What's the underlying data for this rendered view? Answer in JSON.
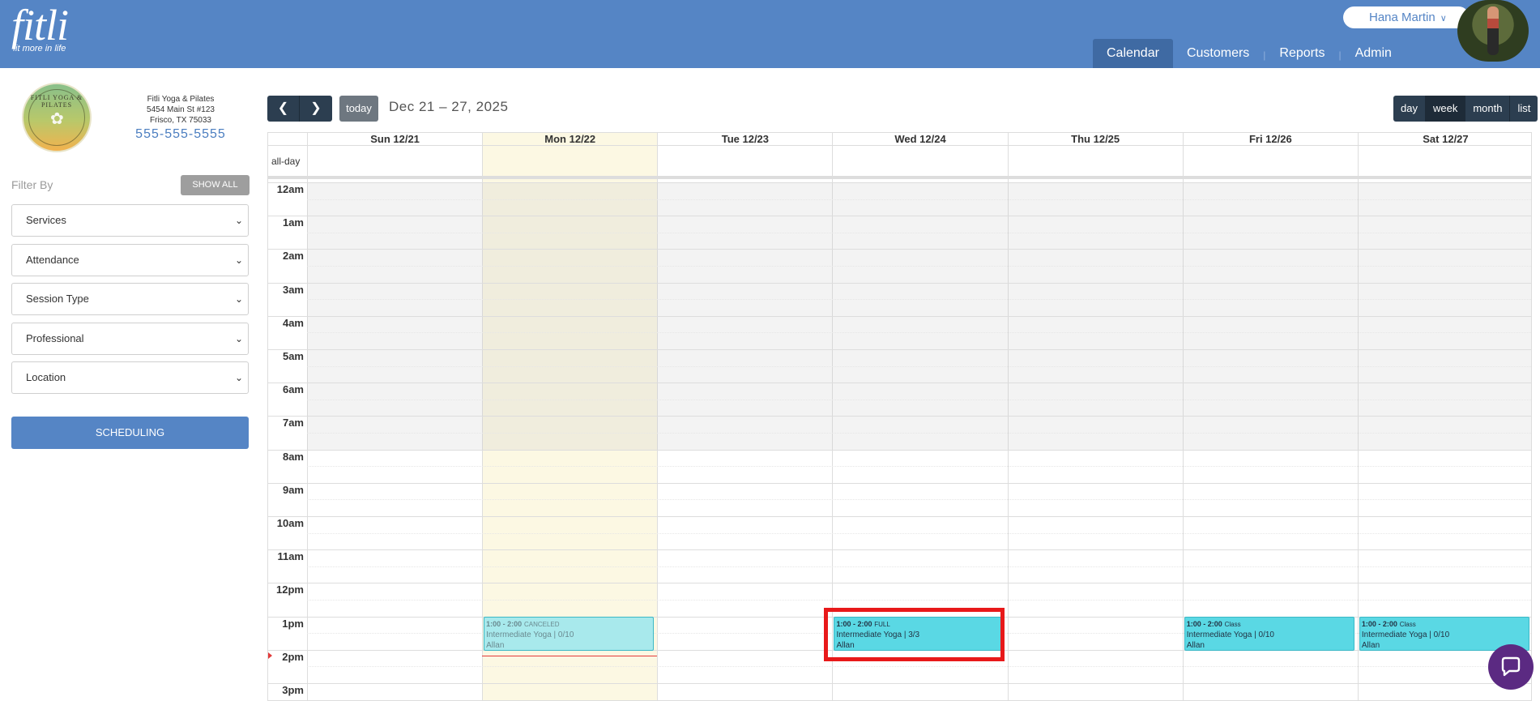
{
  "app": {
    "logo": "fitli",
    "tagline": "fit more in life"
  },
  "user": {
    "name": "Hana Martin"
  },
  "nav": {
    "items": [
      "Calendar",
      "Customers",
      "Reports",
      "Admin"
    ],
    "active": "Calendar"
  },
  "studio": {
    "logo_text": "FITLI YOGA & PILATES",
    "name": "Fitli Yoga & Pilates",
    "address1": "5454 Main St #123",
    "address2": "Frisco, TX 75033",
    "phone": "555-555-5555"
  },
  "filters": {
    "label": "Filter By",
    "show_all": "SHOW ALL",
    "selects": [
      "Services",
      "Attendance",
      "Session Type",
      "Professional",
      "Location"
    ]
  },
  "scheduling_button": "SCHEDULING",
  "toolbar": {
    "today": "today",
    "range_title": "Dec 21 – 27, 2025",
    "views": [
      "day",
      "week",
      "month",
      "list"
    ],
    "active_view": "week"
  },
  "calendar": {
    "days": [
      "Sun 12/21",
      "Mon 12/22",
      "Tue 12/23",
      "Wed 12/24",
      "Thu 12/25",
      "Fri 12/26",
      "Sat 12/27"
    ],
    "today_index": 1,
    "allday_label": "all-day",
    "hours": [
      "12am",
      "1am",
      "2am",
      "3am",
      "4am",
      "5am",
      "6am",
      "7am",
      "8am",
      "9am",
      "10am",
      "11am",
      "12pm",
      "1pm",
      "2pm",
      "3pm"
    ],
    "events": [
      {
        "day": 1,
        "time": "1:00 - 2:00",
        "tag": "CANCELED",
        "title": "Intermediate Yoga | 0/10",
        "instructor": "Allan",
        "canceled": true
      },
      {
        "day": 3,
        "time": "1:00 - 2:00",
        "tag": "FULL",
        "title": "Intermediate Yoga | 3/3",
        "instructor": "Allan",
        "highlighted": true
      },
      {
        "day": 5,
        "time": "1:00 - 2:00",
        "tag": "Class",
        "title": "Intermediate Yoga | 0/10",
        "instructor": "Allan"
      },
      {
        "day": 6,
        "time": "1:00 - 2:00",
        "tag": "Class",
        "title": "Intermediate Yoga | 0/10",
        "instructor": "Allan"
      }
    ]
  },
  "colors": {
    "brand": "#5585c5",
    "dark_button": "#2c3e50",
    "event": "#5ad8e4",
    "highlight": "#e8191a",
    "chat": "#5b2a82"
  }
}
